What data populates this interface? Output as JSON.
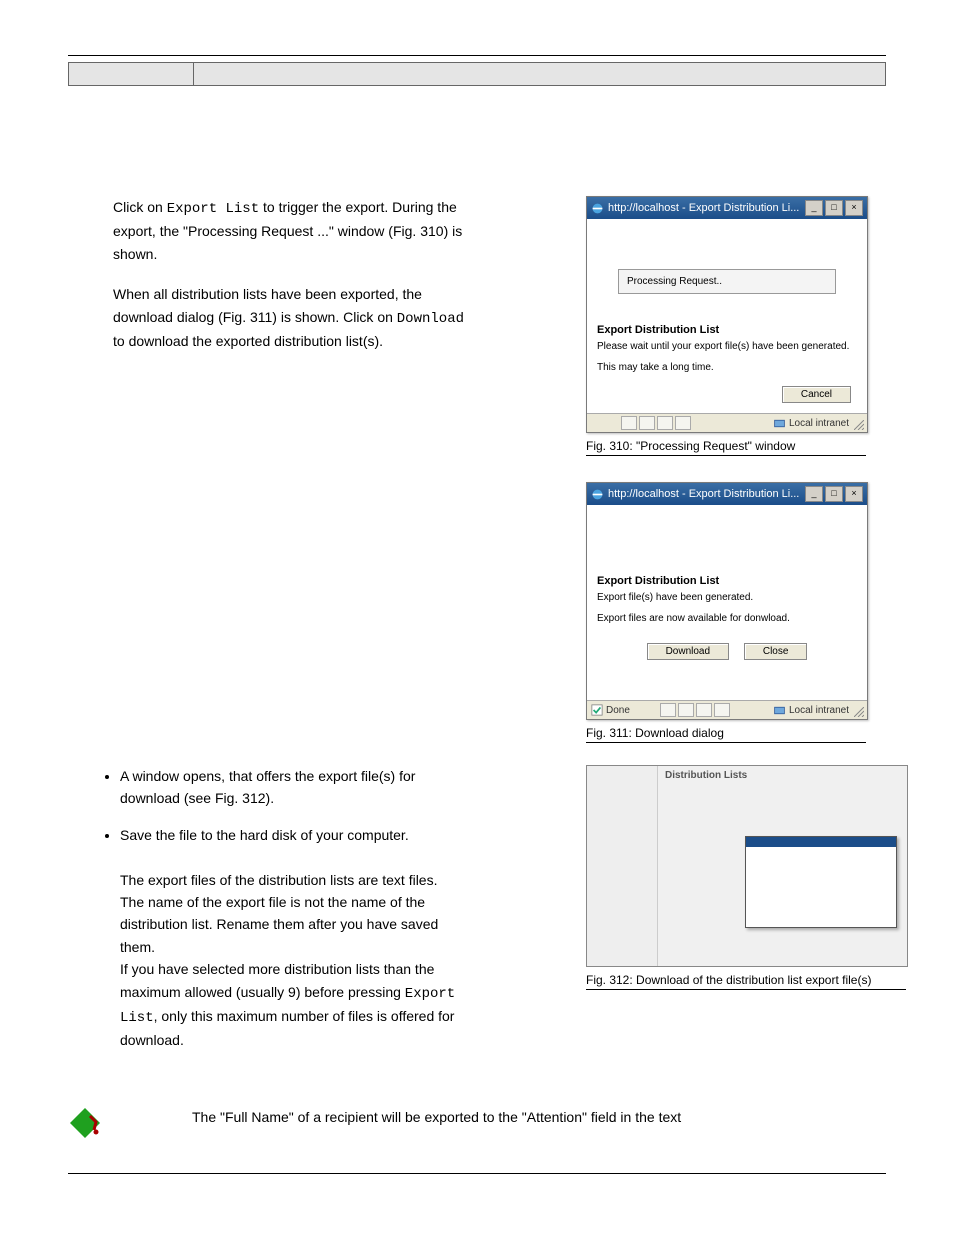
{
  "header": {},
  "intro": {
    "para1_a": "Click on ",
    "para1_b": " to trigger the export. During the export, the \"Processing Request ...\" window (",
    "para1_c": ") is shown.",
    "export_list_label": "Export List",
    "para2_a": "When all distribution lists have been exported, the download dialog (",
    "para2_b": ") is shown. Click on ",
    "para2_c": " to download the exported distribution list(s).",
    "download_label": "Download"
  },
  "dialog1": {
    "title": "http://localhost - Export Distribution Li...",
    "processing": "Processing Request..",
    "heading": "Export Distribution List",
    "line1": "Please wait until your export file(s) have been generated.",
    "line2": "This may take a long time.",
    "cancel": "Cancel",
    "zone": "Local intranet",
    "caption": "Fig. 310: \"Processing Request\" window"
  },
  "dialog2": {
    "title": "http://localhost - Export Distribution Li...",
    "heading": "Export Distribution List",
    "line1": "Export file(s) have been generated.",
    "line2": "Export files are now available for donwload.",
    "download": "Download",
    "close": "Close",
    "done": "Done",
    "zone": "Local intranet",
    "caption": "Fig. 311: Download dialog"
  },
  "bullets": {
    "b1": "A window opens, that offers the export file(s) for download (see Fig. 312).",
    "b2_a": "Save the file to the hard disk of your computer.",
    "b2_b": "The export files of the distribution lists are text files. The name of the export file is not the name of the distribution list. Rename them after you have saved them.",
    "b2_c": "If you have selected more distribution lists than the maximum allowed (usually 9) before pressing ",
    "b2_d": ", only this maximum number of files is offered for download.",
    "export_list_label": "Export List"
  },
  "shot3": {
    "title": "Distribution Lists",
    "caption": "Fig. 312: Download of the distribution list export file(s)"
  },
  "note": {
    "text": "The \"Full Name\" of a recipient will be exported to the \"Attention\" field in the text"
  }
}
